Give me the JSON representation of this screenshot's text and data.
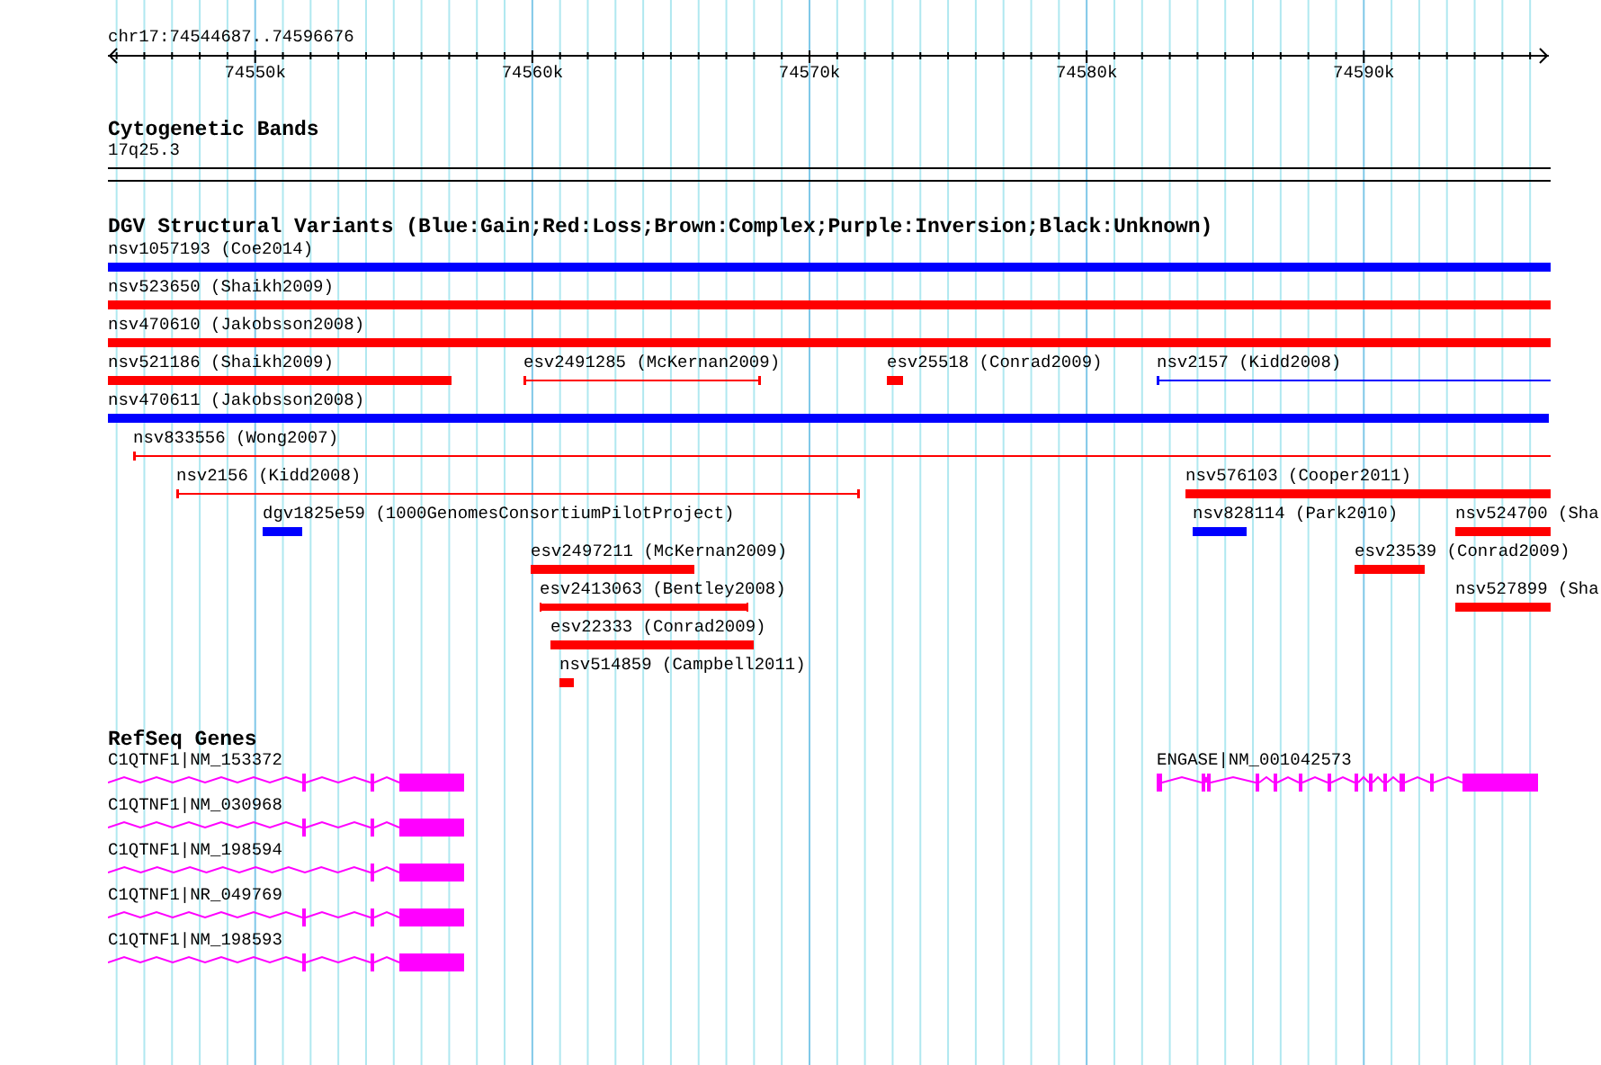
{
  "ruler": {
    "location": "chr17:74544687..74596676",
    "ticks": [
      "74550k",
      "74560k",
      "74570k",
      "74580k",
      "74590k"
    ]
  },
  "cytogenetic_bands": {
    "title": "Cytogenetic Bands",
    "band": "17q25.3"
  },
  "dgv": {
    "title": "DGV Structural Variants (Blue:Gain;Red:Loss;Brown:Complex;Purple:Inversion;Black:Unknown)",
    "variants": [
      {
        "label": "nsv1057193 (Coe2014)",
        "kind": "bar",
        "color": "#0000ff"
      },
      {
        "label": "nsv523650 (Shaikh2009)",
        "kind": "bar",
        "color": "#ff0000"
      },
      {
        "label": "nsv470610 (Jakobsson2008)",
        "kind": "bar",
        "color": "#ff0000"
      },
      {
        "label": "nsv521186 (Shaikh2009)",
        "kind": "bar",
        "color": "#ff0000"
      },
      {
        "label": "esv2491285 (McKernan2009)",
        "kind": "line",
        "color": "#ff0000"
      },
      {
        "label": "esv25518 (Conrad2009)",
        "kind": "bar",
        "color": "#ff0000"
      },
      {
        "label": "nsv2157 (Kidd2008)",
        "kind": "line",
        "color": "#0000ff"
      },
      {
        "label": "nsv470611 (Jakobsson2008)",
        "kind": "bar",
        "color": "#0000ff"
      },
      {
        "label": "nsv833556 (Wong2007)",
        "kind": "line",
        "color": "#ff0000"
      },
      {
        "label": "nsv2156 (Kidd2008)",
        "kind": "line",
        "color": "#ff0000"
      },
      {
        "label": "nsv576103 (Cooper2011)",
        "kind": "bar",
        "color": "#ff0000"
      },
      {
        "label": "dgv1825e59 (1000GenomesConsortiumPilotProject)",
        "kind": "bar",
        "color": "#0000ff"
      },
      {
        "label": "nsv828114 (Park2010)",
        "kind": "bar",
        "color": "#0000ff"
      },
      {
        "label": "nsv524700 (Sha",
        "kind": "bar",
        "color": "#ff0000"
      },
      {
        "label": "esv2497211 (McKernan2009)",
        "kind": "bar",
        "color": "#ff0000"
      },
      {
        "label": "esv23539 (Conrad2009)",
        "kind": "bar",
        "color": "#ff0000"
      },
      {
        "label": "esv2413063 (Bentley2008)",
        "kind": "capped-bar",
        "color": "#ff0000"
      },
      {
        "label": "nsv527899 (Sha",
        "kind": "bar",
        "color": "#ff0000"
      },
      {
        "label": "esv22333 (Conrad2009)",
        "kind": "bar",
        "color": "#ff0000"
      },
      {
        "label": "nsv514859 (Campbell2011)",
        "kind": "bar",
        "color": "#ff0000"
      }
    ]
  },
  "refseq": {
    "title": "RefSeq Genes",
    "genes": [
      {
        "label": "C1QTNF1|NM_153372"
      },
      {
        "label": "C1QTNF1|NM_030968"
      },
      {
        "label": "C1QTNF1|NM_198594"
      },
      {
        "label": "C1QTNF1|NR_049769"
      },
      {
        "label": "C1QTNF1|NM_198593"
      },
      {
        "label": "ENGASE|NM_001042573"
      }
    ]
  }
}
